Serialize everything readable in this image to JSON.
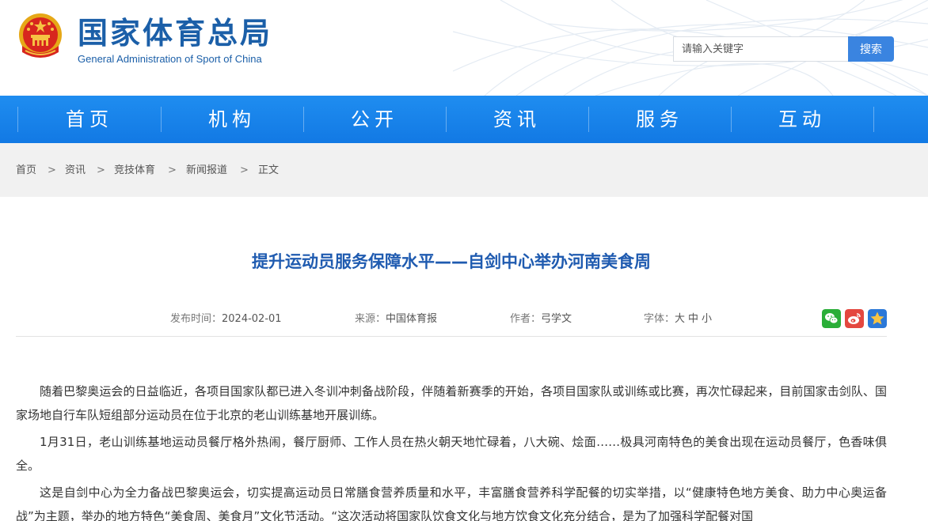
{
  "site": {
    "name_cn": "国家体育总局",
    "name_en": "General Administration of Sport of China"
  },
  "search": {
    "placeholder": "请输入关键字",
    "button_label": "搜索"
  },
  "nav": {
    "items": [
      {
        "label": "首页"
      },
      {
        "label": "机构"
      },
      {
        "label": "公开"
      },
      {
        "label": "资讯"
      },
      {
        "label": "服务"
      },
      {
        "label": "互动"
      }
    ]
  },
  "breadcrumb": {
    "items": [
      "首页",
      "资讯",
      "竞技体育",
      "新闻报道",
      "正文"
    ],
    "separator": ">"
  },
  "article": {
    "title": "提升运动员服务保障水平——自剑中心举办河南美食周",
    "publish_label": "发布时间：",
    "publish_date": "2024-02-01",
    "source_label": "来源：",
    "source": "中国体育报",
    "author_label": "作者：",
    "author": "弓学文",
    "font_label": "字体：",
    "font_sizes": [
      "大",
      "中",
      "小"
    ],
    "paragraphs": [
      "随着巴黎奥运会的日益临近，各项目国家队都已进入冬训冲刺备战阶段，伴随着新赛季的开始，各项目国家队或训练或比赛，再次忙碌起来，目前国家击剑队、国家场地自行车队短组部分运动员在位于北京的老山训练基地开展训练。",
      "1月31日，老山训练基地运动员餐厅格外热闹，餐厅厨师、工作人员在热火朝天地忙碌着，八大碗、烩面……极具河南特色的美食出现在运动员餐厅，色香味俱全。",
      "这是自剑中心为全力备战巴黎奥运会，切实提高运动员日常膳食营养质量和水平，丰富膳食营养科学配餐的切实举措，以“健康特色地方美食、助力中心奥运备战”为主题，举办的地方特色“美食周、美食月”文化节活动。“这次活动将国家队饮食文化与地方饮食文化充分结合，是为了加强科学配餐对国"
    ]
  },
  "share": {
    "icons": [
      "wechat-icon",
      "weibo-icon",
      "favorite-icon"
    ]
  },
  "colors": {
    "brand_blue": "#1b5fa8",
    "nav_blue": "#1279e4",
    "title_blue": "#1f5bb0",
    "search_button": "#3a84e0",
    "wechat_green": "#2aae38",
    "weibo_red": "#e4473f",
    "favorite_blue": "#2b78d8"
  }
}
